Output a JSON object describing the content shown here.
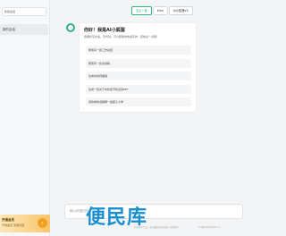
{
  "sidebar": {
    "new_chat_label": "新建会话",
    "history": [
      {
        "label": "新的会话"
      }
    ],
    "promo": {
      "line1": "开通会员",
      "line2": "开通会员 无限对话",
      "icon": "arrow-right-icon"
    }
  },
  "models": {
    "tabs": [
      {
        "label": "文心一言",
        "active": true
      },
      {
        "label": "Kimi",
        "active": false
      },
      {
        "label": "AI小狐狸V2",
        "active": false
      }
    ]
  },
  "greeting": {
    "title": "你好！我是AI小狐狸",
    "subtitle": "我擅长写文案、写代码，可以帮助你快速写作，赶快试一试吧！",
    "suggestions": [
      {
        "label": "帮我写一篇工作总结"
      },
      {
        "label": "帮我写一篇演讲稿"
      },
      {
        "label": "生成中秋祝福语"
      },
      {
        "label": "生成一篇关于中秋佳节的演讲PPT"
      },
      {
        "label": "用简单的话解释一遍量子力学"
      }
    ]
  },
  "composer": {
    "placeholder": "输入你想问的..."
  },
  "footer": {
    "note": "内容由AI生成，无法确保真实准确，仅供参考",
    "beian": "ICP备00000000号-1"
  },
  "watermark": {
    "text": "便民库"
  },
  "colors": {
    "accent": "#2fb380",
    "promo": "#f0a020",
    "watermark": "#1a8fd0"
  }
}
